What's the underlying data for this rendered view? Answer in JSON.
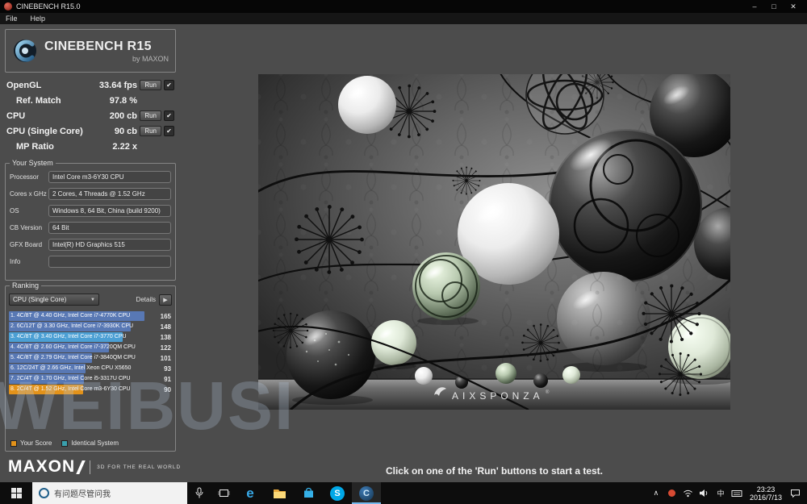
{
  "window": {
    "title": "CINEBENCH R15.0",
    "menu": [
      "File",
      "Help"
    ]
  },
  "logo": {
    "title": "CINEBENCH R15",
    "subtitle": "by MAXON"
  },
  "run_label": "Run",
  "benchmarks": [
    {
      "label": "OpenGL",
      "value": "33.64 fps",
      "has_run": true,
      "done": true
    },
    {
      "label": "Ref. Match",
      "value": "97.8 %",
      "has_run": false,
      "done": false
    },
    {
      "label": "CPU",
      "value": "200 cb",
      "has_run": true,
      "done": true
    },
    {
      "label": "CPU (Single Core)",
      "value": "90 cb",
      "has_run": true,
      "done": true
    },
    {
      "label": "MP Ratio",
      "value": "2.22 x",
      "has_run": false,
      "done": false
    }
  ],
  "your_system": {
    "title": "Your System",
    "rows": [
      {
        "label": "Processor",
        "value": "Intel Core m3-6Y30 CPU"
      },
      {
        "label": "Cores x GHz",
        "value": "2 Cores, 4 Threads @ 1.52 GHz"
      },
      {
        "label": "OS",
        "value": "Windows 8, 64 Bit, China (build 9200)"
      },
      {
        "label": "CB Version",
        "value": "64 Bit"
      },
      {
        "label": "GFX Board",
        "value": "Intel(R) HD Graphics 515"
      },
      {
        "label": "Info",
        "value": ""
      }
    ]
  },
  "ranking": {
    "title": "Ranking",
    "filter": "CPU (Single Core)",
    "details_label": "Details",
    "max_score": 165,
    "bar_colors": {
      "normal": "#5878b4",
      "highlight": "#4b9fd4",
      "your": "#e2921a"
    },
    "entries": [
      {
        "label": "1. 4C/8T @ 4.40 GHz, Intel Core i7-4770K CPU",
        "score": 165,
        "type": "normal"
      },
      {
        "label": "2. 6C/12T @ 3.30 GHz, Intel Core i7-3930K CPU",
        "score": 148,
        "type": "normal"
      },
      {
        "label": "3. 4C/8T @ 3.40 GHz, Intel Core i7-3770 CPU",
        "score": 138,
        "type": "highlight"
      },
      {
        "label": "4. 4C/8T @ 2.60 GHz, Intel Core i7-3720QM CPU",
        "score": 122,
        "type": "normal"
      },
      {
        "label": "5. 4C/8T @ 2.79 GHz, Intel Core i7-3840QM CPU",
        "score": 101,
        "type": "normal"
      },
      {
        "label": "6. 12C/24T @ 2.66 GHz, Intel Xeon CPU X5650",
        "score": 93,
        "type": "normal"
      },
      {
        "label": "7. 2C/4T @ 1.70 GHz, Intel Core i5-3317U CPU",
        "score": 91,
        "type": "normal"
      },
      {
        "label": "8. 2C/4T @ 1.52 GHz, Intel Core m3-6Y30 CPU",
        "score": 90,
        "type": "your"
      }
    ],
    "legend": [
      {
        "label": "Your Score",
        "color": "#e2921a"
      },
      {
        "label": "Identical System",
        "color": "#3aa0ad"
      }
    ]
  },
  "maxon": {
    "name": "MAXON",
    "tagline": "3D FOR THE REAL WORLD"
  },
  "main": {
    "instruction": "Click on one of the 'Run' buttons to start a test.",
    "render_credit": "AIXSPONZA",
    "reg_mark": "®"
  },
  "watermark": "WEIBUSI",
  "taskbar": {
    "search_text": "有问题尽管问我",
    "ime_indicator": "中",
    "time": "23:23",
    "date": "2016/7/13"
  },
  "icons": {
    "check": "✔",
    "caret_down": "▼",
    "play": "▶",
    "minimize": "–",
    "maximize": "□",
    "close": "✕",
    "chevron_up": "∧",
    "edge": "e",
    "skype": "S",
    "cinebench": "C"
  }
}
